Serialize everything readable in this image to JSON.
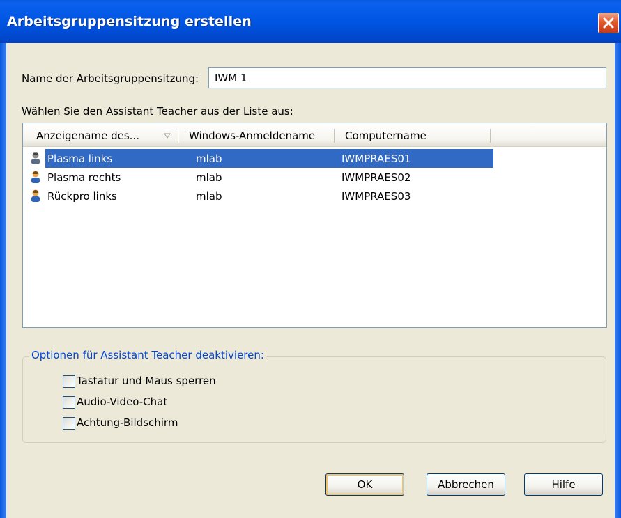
{
  "window": {
    "title": "Arbeitsgruppensitzung erstellen"
  },
  "name_field": {
    "label": "Name der Arbeitsgruppensitzung:",
    "value": "IWM 1"
  },
  "list": {
    "label": "Wählen Sie den Assistant Teacher aus der Liste aus:",
    "columns": [
      "Anzeigename des...",
      "Windows-Anmeldename",
      "Computername"
    ],
    "rows": [
      {
        "display_name": "Plasma links",
        "login": "mlab",
        "computer": "IWMPRAES01",
        "selected": true
      },
      {
        "display_name": "Plasma rechts",
        "login": "mlab",
        "computer": "IWMPRAES02",
        "selected": false
      },
      {
        "display_name": "Rückpro links",
        "login": "mlab",
        "computer": "IWMPRAES03",
        "selected": false
      }
    ]
  },
  "options": {
    "title": "Optionen für Assistant Teacher deaktivieren:",
    "items": [
      {
        "label": "Tastatur und Maus sperren",
        "checked": false
      },
      {
        "label": "Audio-Video-Chat",
        "checked": false
      },
      {
        "label": "Achtung-Bildschirm",
        "checked": false
      }
    ]
  },
  "buttons": {
    "ok": "OK",
    "cancel": "Abbrechen",
    "help": "Hilfe"
  },
  "colors": {
    "title_bar": "#0055e3",
    "selection": "#316ac5",
    "group_title": "#0046d5"
  }
}
